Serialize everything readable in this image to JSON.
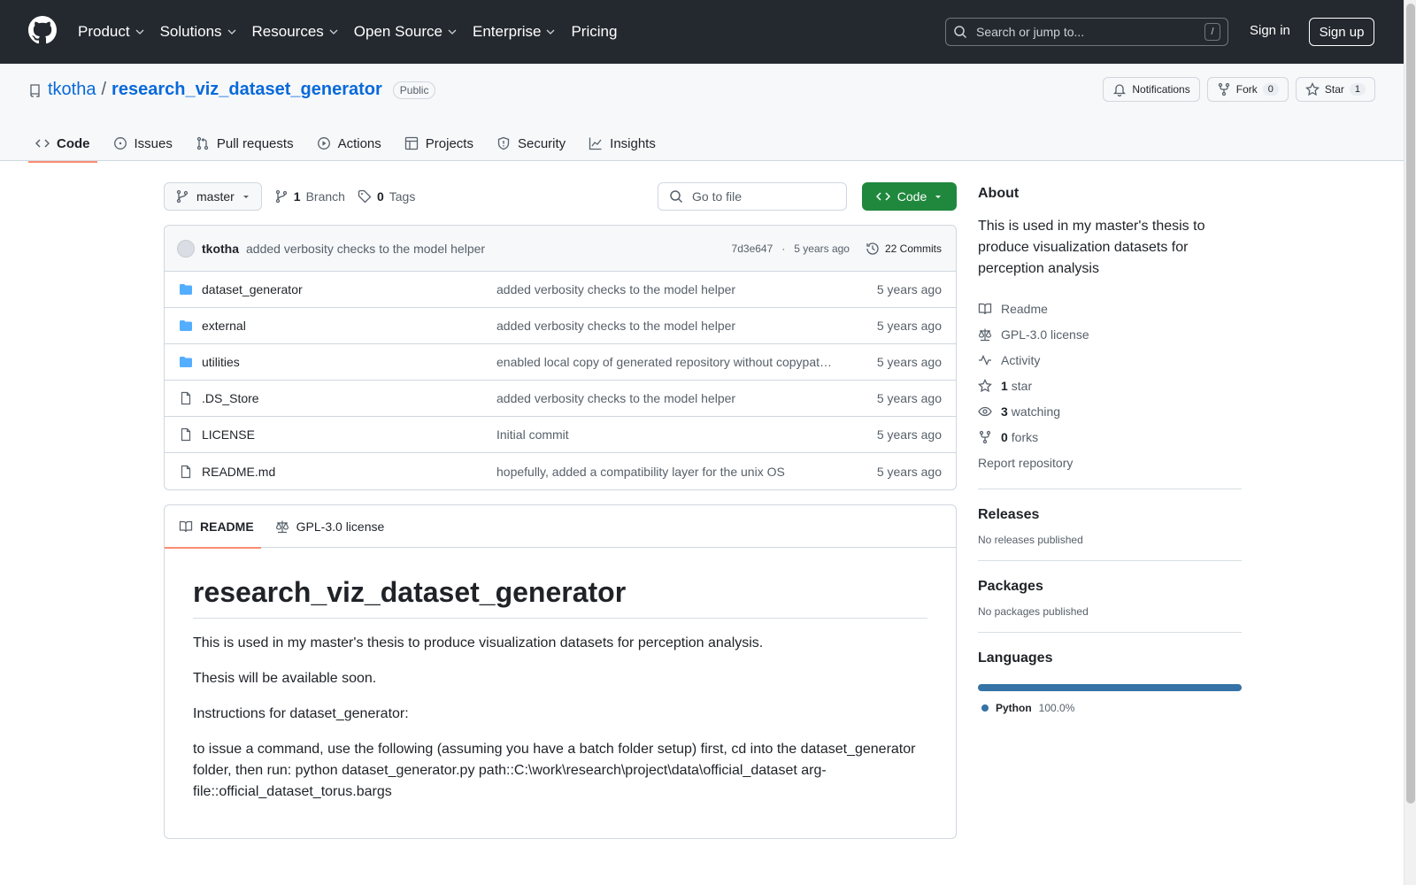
{
  "header": {
    "nav": [
      "Product",
      "Solutions",
      "Resources",
      "Open Source",
      "Enterprise",
      "Pricing"
    ],
    "search_placeholder": "Search or jump to...",
    "search_key": "/",
    "sign_in": "Sign in",
    "sign_up": "Sign up"
  },
  "repo": {
    "owner": "tkotha",
    "separator": "/",
    "name": "research_viz_dataset_generator",
    "visibility": "Public",
    "notifications_label": "Notifications",
    "fork_label": "Fork",
    "fork_count": "0",
    "star_label": "Star",
    "star_count": "1",
    "tabs": [
      "Code",
      "Issues",
      "Pull requests",
      "Actions",
      "Projects",
      "Security",
      "Insights"
    ]
  },
  "toolbar": {
    "branch": "master",
    "branch_count": "1",
    "branch_label": "Branch",
    "tag_count": "0",
    "tag_label": "Tags",
    "goto_placeholder": "Go to file",
    "code_label": "Code"
  },
  "commit": {
    "author": "tkotha",
    "message": "added verbosity checks to the model helper",
    "hash": "7d3e647",
    "dot": "·",
    "age": "5 years ago",
    "commits_label": "22 Commits"
  },
  "files": [
    {
      "name": "dataset_generator",
      "type": "dir",
      "message": "added verbosity checks to the model helper",
      "age": "5 years ago"
    },
    {
      "name": "external",
      "type": "dir",
      "message": "added verbosity checks to the model helper",
      "age": "5 years ago"
    },
    {
      "name": "utilities",
      "type": "dir",
      "message": "enabled local copy of generated repository without copypath (i.e. path::)",
      "age": "5 years ago"
    },
    {
      "name": ".DS_Store",
      "type": "file",
      "message": "added verbosity checks to the model helper",
      "age": "5 years ago"
    },
    {
      "name": "LICENSE",
      "type": "file",
      "message": "Initial commit",
      "age": "5 years ago"
    },
    {
      "name": "README.md",
      "type": "file",
      "message": "hopefully, added a compatibility layer for the unix OS",
      "age": "5 years ago"
    }
  ],
  "readme": {
    "tab_readme": "README",
    "tab_license": "GPL-3.0 license",
    "title": "research_viz_dataset_generator",
    "p1": "This is used in my master's thesis to produce visualization datasets for perception analysis.",
    "p2": "Thesis will be available soon.",
    "p3": "Instructions for dataset_generator:",
    "p4": "to issue a command, use the following (assuming you have a batch folder setup) first, cd into the dataset_generator folder, then run: python dataset_generator.py path::C:\\work\\research\\project\\data\\official_dataset arg-file::official_dataset_torus.bargs"
  },
  "sidebar": {
    "about_title": "About",
    "about_text": "This is used in my master's thesis to produce visualization datasets for perception analysis",
    "readme": "Readme",
    "license": "GPL-3.0 license",
    "activity": "Activity",
    "stars_count": "1",
    "stars_label": "star",
    "watching_count": "3",
    "watching_label": "watching",
    "forks_count": "0",
    "forks_label": "forks",
    "report": "Report repository",
    "releases_title": "Releases",
    "releases_text": "No releases published",
    "packages_title": "Packages",
    "packages_text": "No packages published",
    "languages_title": "Languages",
    "language_name": "Python",
    "language_pct": "100.0%",
    "language_share": 1.0,
    "language_color": "#3572A5"
  },
  "colors": {
    "header_bg": "#24292f",
    "link": "#0969da",
    "primary_button": "#1f883d",
    "tab_underline": "#fd8c73",
    "folder": "#54aeff"
  }
}
